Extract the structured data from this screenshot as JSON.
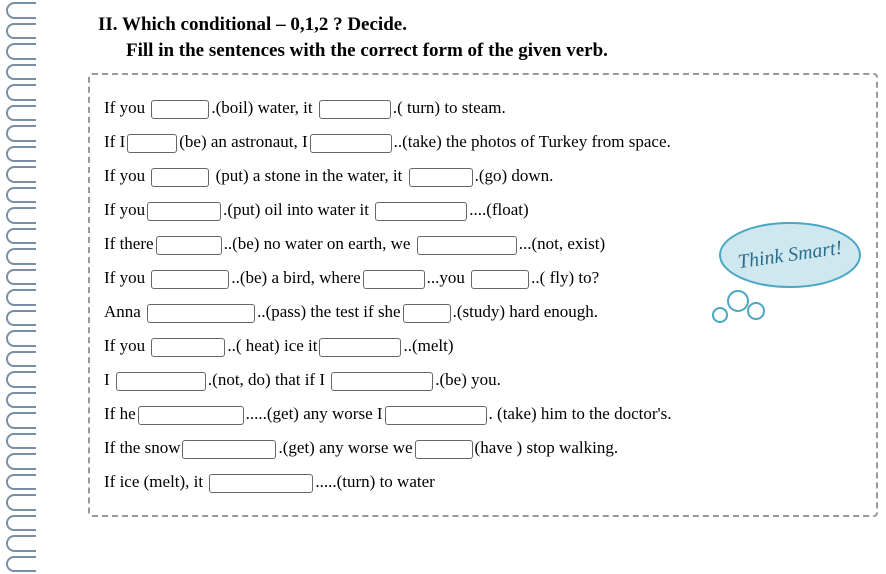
{
  "title": {
    "line1": "II. Which conditional – 0,1,2 ? Decide.",
    "line2": "Fill in the sentences with the correct form  of the given verb."
  },
  "bubble_text": "Think Smart!",
  "sentences": [
    {
      "parts": [
        "If you ",
        {
          "blank": 56
        },
        ".(boil) water, it ",
        {
          "blank": 70
        },
        ".( turn) to steam."
      ]
    },
    {
      "parts": [
        "If I",
        {
          "blank": 48
        },
        "(be) an astronaut, I",
        {
          "blank": 80
        },
        "..(take) the photos of Turkey from space."
      ]
    },
    {
      "parts": [
        "If you ",
        {
          "blank": 56
        },
        " (put) a stone in the water, it ",
        {
          "blank": 62
        },
        ".(go) down."
      ]
    },
    {
      "parts": [
        "If you",
        {
          "blank": 72
        },
        ".(put) oil into water it  ",
        {
          "blank": 90
        },
        "....(float)"
      ]
    },
    {
      "parts": [
        "If there",
        {
          "blank": 64
        },
        "..(be) no water on earth, we ",
        {
          "blank": 98
        },
        "...(not, exist)"
      ]
    },
    {
      "parts": [
        "If you ",
        {
          "blank": 76
        },
        "..(be) a bird, where",
        {
          "blank": 60
        },
        "...you ",
        {
          "blank": 56
        },
        "..( fly) to?"
      ]
    },
    {
      "parts": [
        "Anna ",
        {
          "blank": 106
        },
        "..(pass) the test if she",
        {
          "blank": 46
        },
        ".(study) hard enough."
      ]
    },
    {
      "parts": [
        "If you ",
        {
          "blank": 72
        },
        "..( heat)  ice it",
        {
          "blank": 80
        },
        "..(melt)"
      ]
    },
    {
      "parts": [
        "I ",
        {
          "blank": 88
        },
        ".(not, do) that if I ",
        {
          "blank": 100
        },
        ".(be) you."
      ]
    },
    {
      "parts": [
        "If he",
        {
          "blank": 104
        },
        ".....(get) any worse I",
        {
          "blank": 100
        },
        ". (take) him to the doctor's."
      ]
    },
    {
      "parts": [
        "If the snow",
        {
          "blank": 92
        },
        ".(get) any worse we",
        {
          "blank": 56
        },
        "(have ) stop walking."
      ]
    },
    {
      "parts": [
        "If ice (melt), it ",
        {
          "blank": 102
        },
        ".....(turn) to water"
      ]
    }
  ]
}
